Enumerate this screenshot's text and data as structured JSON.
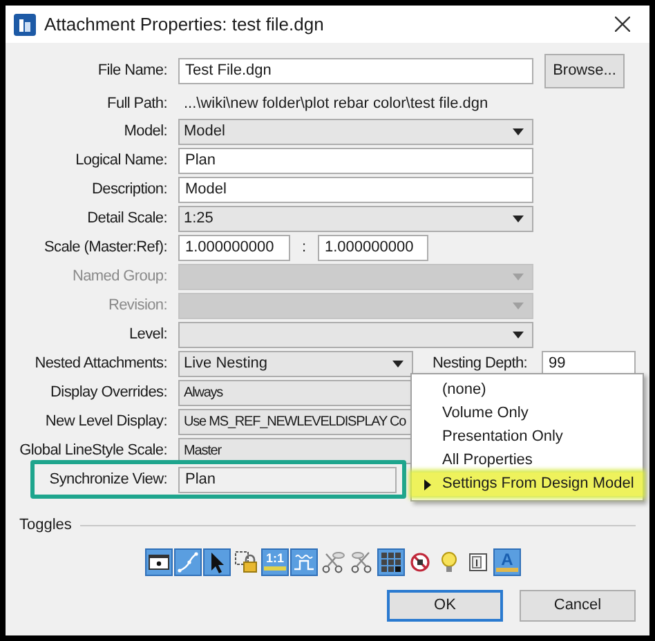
{
  "window": {
    "title": "Attachment Properties: test file.dgn"
  },
  "fields": [
    {
      "kind": "text",
      "label": "File Name:",
      "value": "Test File.dgn",
      "disabled": false,
      "button": "Browse..."
    },
    {
      "kind": "static",
      "label": "Full Path:",
      "value": "...\\wiki\\new folder\\plot rebar color\\test file.dgn",
      "disabled": false
    },
    {
      "kind": "combo",
      "label": "Model:",
      "value": "Model",
      "disabled": false
    },
    {
      "kind": "text",
      "label": "Logical Name:",
      "value": "Plan",
      "disabled": false
    },
    {
      "kind": "text",
      "label": "Description:",
      "value": "Model",
      "disabled": false
    },
    {
      "kind": "combo",
      "label": "Detail Scale:",
      "value": "1:25",
      "disabled": false
    },
    {
      "kind": "scale",
      "label": "Scale (Master:Ref):",
      "value": "1.000000000",
      "separator": ":",
      "value2": "1.000000000",
      "disabled": false
    },
    {
      "kind": "combo",
      "label": "Named Group:",
      "disabled": true
    },
    {
      "kind": "combo",
      "label": "Revision:",
      "disabled": true
    },
    {
      "kind": "combo",
      "label": "Level:",
      "disabled": false
    },
    {
      "kind": "nested",
      "label": "Nested Attachments:",
      "value": "Live Nesting",
      "label2": "Nesting Depth:",
      "value2": "99",
      "disabled": false
    },
    {
      "kind": "covered",
      "label": "Display Overrides:",
      "value": "Always",
      "disabled": false
    },
    {
      "kind": "covered",
      "label": "New Level Display:",
      "value": "Use MS_REF_NEWLEVELDISPLAY Co",
      "disabled": false
    },
    {
      "kind": "covered",
      "label": "Global LineStyle Scale:",
      "value": "Master",
      "disabled": false
    },
    {
      "kind": "readonly",
      "label": "Synchronize View:",
      "value": "Plan",
      "disabled": false,
      "highlighted": true
    }
  ],
  "popup_menu": {
    "items": [
      {
        "label": "(none)",
        "selected": false
      },
      {
        "label": "Volume Only",
        "selected": false
      },
      {
        "label": "Presentation Only",
        "selected": false
      },
      {
        "label": "All Properties",
        "selected": false
      },
      {
        "label": "Settings From Design Model",
        "selected": true
      }
    ]
  },
  "toggles": {
    "title": "Toggles",
    "items": [
      {
        "on": true
      },
      {
        "on": true
      },
      {
        "on": true
      },
      {
        "on": false
      },
      {
        "on": true,
        "text": "1:1"
      },
      {
        "on": true
      },
      {
        "on": false
      },
      {
        "on": false
      },
      {
        "on": true
      },
      {
        "on": false
      },
      {
        "on": false
      },
      {
        "on": false
      },
      {
        "on": true,
        "text": "A"
      }
    ]
  },
  "buttons": [
    {
      "label": "OK",
      "default": true
    },
    {
      "label": "Cancel",
      "default": false
    }
  ]
}
